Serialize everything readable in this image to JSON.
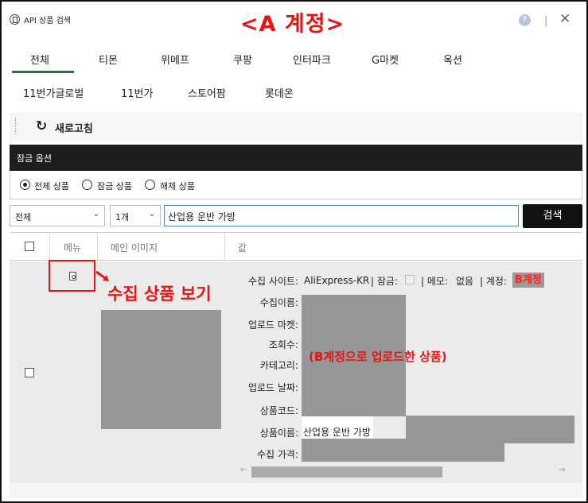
{
  "window": {
    "title": "API 상품 검색",
    "annotation": "<A 계정>",
    "help_label": "?",
    "separator": "|",
    "close_label": "✕"
  },
  "tabs": {
    "row1": [
      "전체",
      "티몬",
      "위메프",
      "쿠팡",
      "인터파크",
      "G마켓",
      "옥션"
    ],
    "row2": [
      "11번가글로벌",
      "11번가",
      "스토어팜",
      "롯데온"
    ],
    "active": "전체"
  },
  "toolbar": {
    "refresh_label": "새로고침",
    "refresh_icon": "refresh-icon"
  },
  "lock_options": {
    "title": "잠금 옵션",
    "options": [
      "전체 상품",
      "잠금 상품",
      "해제 상품"
    ],
    "selected": "전체 상품"
  },
  "search": {
    "filter_select": "전체",
    "count_select": "1개",
    "query": "산업용 운반 가방",
    "button_label": "검색"
  },
  "table": {
    "headers": [
      "메뉴",
      "메인 이미지",
      "값"
    ],
    "row": {
      "fields": [
        {
          "label": "수집 사이트:",
          "value": "AliExpress-KR"
        },
        {
          "label": "수집이름:",
          "value": ""
        },
        {
          "label": "업로드 마켓:",
          "value": ""
        },
        {
          "label": "조회수:",
          "value": ""
        },
        {
          "label": "카테고리:",
          "value": ""
        },
        {
          "label": "업로드 날짜:",
          "value": ""
        },
        {
          "label": "상품코드:",
          "value": ""
        },
        {
          "label": "상품이름:",
          "value": "산업용 운반 가방"
        },
        {
          "label": "수집 가격:",
          "value": ""
        }
      ],
      "lock_label": "| 잠금:",
      "memo_label": "| 메모:",
      "memo_value": "없음",
      "account_label": "| 계정:",
      "account_value": "B계정"
    }
  },
  "annotations": {
    "collect_view": "수집 상품 보기",
    "upload_note": "(B계정으로 업로드한 상품)"
  },
  "colors": {
    "accent_green": "#1f7a3a",
    "annotation_red": "#e81313",
    "header_dark": "#1e1e1e",
    "redaction_gray": "#979797"
  }
}
